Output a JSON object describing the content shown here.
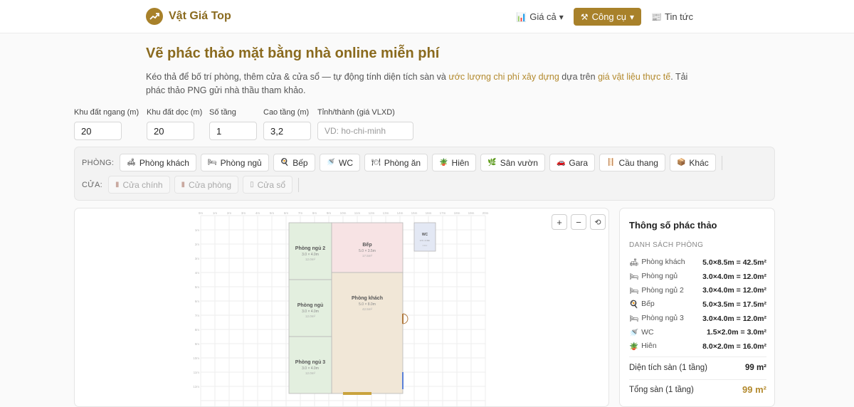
{
  "header": {
    "logo_text": "Vật Giá Top",
    "nav": [
      {
        "icon": "📊",
        "label": "Giá cả"
      },
      {
        "icon": "⚒",
        "label": "Công cụ"
      },
      {
        "icon": "📰",
        "label": "Tin tức"
      }
    ]
  },
  "page": {
    "title": "Vẽ phác thảo mặt bằng nhà online miễn phí",
    "intro_1": "Kéo thả để bố trí phòng, thêm cửa & cửa sổ — tự động tính diện tích sàn và ",
    "intro_link_1": "ước lượng chi phí xây dựng",
    "intro_2": " dựa trên ",
    "intro_link_2": "giá vật liệu thực tế",
    "intro_3": ". Tải phác thảo PNG gửi nhà thầu tham khảo."
  },
  "fields": [
    {
      "label": "Khu đất ngang (m)",
      "value": "20",
      "placeholder": ""
    },
    {
      "label": "Khu đất dọc (m)",
      "value": "20",
      "placeholder": ""
    },
    {
      "label": "Số tầng",
      "value": "1",
      "placeholder": ""
    },
    {
      "label": "Cao tầng (m)",
      "value": "3,2",
      "placeholder": ""
    },
    {
      "label": "Tỉnh/thành (giá VLXD)",
      "value": "",
      "placeholder": "VD: ho-chi-minh"
    }
  ],
  "palette": {
    "rooms_label": "PHÒNG:",
    "rooms": [
      {
        "icon": "🛋",
        "label": "Phòng khách"
      },
      {
        "icon": "🛏",
        "label": "Phòng ngủ"
      },
      {
        "icon": "🍳",
        "label": "Bếp"
      },
      {
        "icon": "🚿",
        "label": "WC"
      },
      {
        "icon": "🍽",
        "label": "Phòng ăn"
      },
      {
        "icon": "🪴",
        "label": "Hiên"
      },
      {
        "icon": "🌿",
        "label": "Sân vườn"
      },
      {
        "icon": "🚗",
        "label": "Gara"
      },
      {
        "icon": "🪜",
        "label": "Cầu thang"
      },
      {
        "icon": "📦",
        "label": "Khác"
      }
    ],
    "doors_label": "CỬA:",
    "doors": [
      {
        "icon": "▮",
        "label": "Cửa chính"
      },
      {
        "icon": "▮",
        "label": "Cửa phòng"
      },
      {
        "icon": "▯",
        "label": "Cửa sổ"
      }
    ]
  },
  "canvas": {
    "zoom_in": "+",
    "zoom_out": "−",
    "reset": "⟲",
    "ruler_x": [
      "0m",
      "1m",
      "2m",
      "3m",
      "4m",
      "5m",
      "6m",
      "7m",
      "8m",
      "9m",
      "10m",
      "11m",
      "12m",
      "13m",
      "14m",
      "15m",
      "16m",
      "17m",
      "18m",
      "19m",
      "20m"
    ],
    "ruler_y": [
      "1m",
      "2m",
      "3m",
      "4m",
      "5m",
      "6m",
      "7m",
      "8m",
      "9m",
      "10m",
      "11m",
      "12m"
    ],
    "rooms": [
      {
        "name": "Phòng ngủ 2",
        "dims": "3.0 × 4.0m",
        "area": "12.0m²"
      },
      {
        "name": "Bếp",
        "dims": "5.0 × 3.5m",
        "area": "17.5m²"
      },
      {
        "name": "WC",
        "dims": "1.5 × 2.0m",
        "area": "3.0m²"
      },
      {
        "name": "Phòng ngủ",
        "dims": "3.0 × 4.0m",
        "area": "12.0m²"
      },
      {
        "name": "Phòng khách",
        "dims": "5.0 × 8.0m",
        "area": "42.5m²"
      },
      {
        "name": "Phòng ngủ 3",
        "dims": "3.0 × 4.0m",
        "area": "12.0m²"
      }
    ]
  },
  "panel": {
    "title": "Thông số phác thảo",
    "subtitle": "DANH SÁCH PHÒNG",
    "rooms": [
      {
        "icon": "🛋",
        "name": "Phòng khách",
        "size": "5.0×8.5m = 42.5m²"
      },
      {
        "icon": "🛏",
        "name": "Phòng ngủ",
        "size": "3.0×4.0m = 12.0m²"
      },
      {
        "icon": "🛏",
        "name": "Phòng ngủ 2",
        "size": "3.0×4.0m = 12.0m²"
      },
      {
        "icon": "🍳",
        "name": "Bếp",
        "size": "5.0×3.5m = 17.5m²"
      },
      {
        "icon": "🛏",
        "name": "Phòng ngủ 3",
        "size": "3.0×4.0m = 12.0m²"
      },
      {
        "icon": "🚿",
        "name": "WC",
        "size": "1.5×2.0m = 3.0m²"
      },
      {
        "icon": "🪴",
        "name": "Hiên",
        "size": "8.0×2.0m = 16.0m²"
      }
    ],
    "floor_area_label": "Diện tích sàn (1 tầng)",
    "floor_area_value": "99 m²",
    "total_label": "Tổng sàn (1 tầng)",
    "total_value": "99 m²"
  },
  "colors": {
    "brand": "#a8812a",
    "title": "#8a6a1e",
    "bedroom_fill": "#e3efdf",
    "kitchen_fill": "#f7e3e4",
    "living_fill": "#f1e7d7",
    "wc_fill": "#e3e8f4"
  }
}
